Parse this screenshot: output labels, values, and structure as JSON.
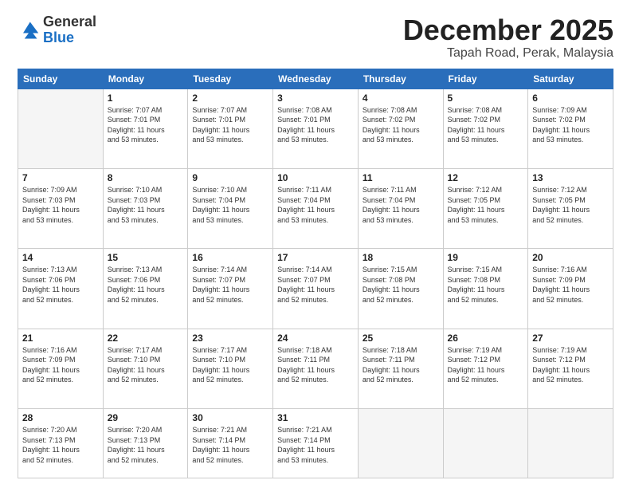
{
  "header": {
    "logo": {
      "general": "General",
      "blue": "Blue"
    },
    "title": "December 2025",
    "subtitle": "Tapah Road, Perak, Malaysia"
  },
  "calendar": {
    "weekdays": [
      "Sunday",
      "Monday",
      "Tuesday",
      "Wednesday",
      "Thursday",
      "Friday",
      "Saturday"
    ],
    "weeks": [
      [
        {
          "day": "",
          "info": ""
        },
        {
          "day": "1",
          "info": "Sunrise: 7:07 AM\nSunset: 7:01 PM\nDaylight: 11 hours\nand 53 minutes."
        },
        {
          "day": "2",
          "info": "Sunrise: 7:07 AM\nSunset: 7:01 PM\nDaylight: 11 hours\nand 53 minutes."
        },
        {
          "day": "3",
          "info": "Sunrise: 7:08 AM\nSunset: 7:01 PM\nDaylight: 11 hours\nand 53 minutes."
        },
        {
          "day": "4",
          "info": "Sunrise: 7:08 AM\nSunset: 7:02 PM\nDaylight: 11 hours\nand 53 minutes."
        },
        {
          "day": "5",
          "info": "Sunrise: 7:08 AM\nSunset: 7:02 PM\nDaylight: 11 hours\nand 53 minutes."
        },
        {
          "day": "6",
          "info": "Sunrise: 7:09 AM\nSunset: 7:02 PM\nDaylight: 11 hours\nand 53 minutes."
        }
      ],
      [
        {
          "day": "7",
          "info": "Sunrise: 7:09 AM\nSunset: 7:03 PM\nDaylight: 11 hours\nand 53 minutes."
        },
        {
          "day": "8",
          "info": "Sunrise: 7:10 AM\nSunset: 7:03 PM\nDaylight: 11 hours\nand 53 minutes."
        },
        {
          "day": "9",
          "info": "Sunrise: 7:10 AM\nSunset: 7:04 PM\nDaylight: 11 hours\nand 53 minutes."
        },
        {
          "day": "10",
          "info": "Sunrise: 7:11 AM\nSunset: 7:04 PM\nDaylight: 11 hours\nand 53 minutes."
        },
        {
          "day": "11",
          "info": "Sunrise: 7:11 AM\nSunset: 7:04 PM\nDaylight: 11 hours\nand 53 minutes."
        },
        {
          "day": "12",
          "info": "Sunrise: 7:12 AM\nSunset: 7:05 PM\nDaylight: 11 hours\nand 53 minutes."
        },
        {
          "day": "13",
          "info": "Sunrise: 7:12 AM\nSunset: 7:05 PM\nDaylight: 11 hours\nand 52 minutes."
        }
      ],
      [
        {
          "day": "14",
          "info": "Sunrise: 7:13 AM\nSunset: 7:06 PM\nDaylight: 11 hours\nand 52 minutes."
        },
        {
          "day": "15",
          "info": "Sunrise: 7:13 AM\nSunset: 7:06 PM\nDaylight: 11 hours\nand 52 minutes."
        },
        {
          "day": "16",
          "info": "Sunrise: 7:14 AM\nSunset: 7:07 PM\nDaylight: 11 hours\nand 52 minutes."
        },
        {
          "day": "17",
          "info": "Sunrise: 7:14 AM\nSunset: 7:07 PM\nDaylight: 11 hours\nand 52 minutes."
        },
        {
          "day": "18",
          "info": "Sunrise: 7:15 AM\nSunset: 7:08 PM\nDaylight: 11 hours\nand 52 minutes."
        },
        {
          "day": "19",
          "info": "Sunrise: 7:15 AM\nSunset: 7:08 PM\nDaylight: 11 hours\nand 52 minutes."
        },
        {
          "day": "20",
          "info": "Sunrise: 7:16 AM\nSunset: 7:09 PM\nDaylight: 11 hours\nand 52 minutes."
        }
      ],
      [
        {
          "day": "21",
          "info": "Sunrise: 7:16 AM\nSunset: 7:09 PM\nDaylight: 11 hours\nand 52 minutes."
        },
        {
          "day": "22",
          "info": "Sunrise: 7:17 AM\nSunset: 7:10 PM\nDaylight: 11 hours\nand 52 minutes."
        },
        {
          "day": "23",
          "info": "Sunrise: 7:17 AM\nSunset: 7:10 PM\nDaylight: 11 hours\nand 52 minutes."
        },
        {
          "day": "24",
          "info": "Sunrise: 7:18 AM\nSunset: 7:11 PM\nDaylight: 11 hours\nand 52 minutes."
        },
        {
          "day": "25",
          "info": "Sunrise: 7:18 AM\nSunset: 7:11 PM\nDaylight: 11 hours\nand 52 minutes."
        },
        {
          "day": "26",
          "info": "Sunrise: 7:19 AM\nSunset: 7:12 PM\nDaylight: 11 hours\nand 52 minutes."
        },
        {
          "day": "27",
          "info": "Sunrise: 7:19 AM\nSunset: 7:12 PM\nDaylight: 11 hours\nand 52 minutes."
        }
      ],
      [
        {
          "day": "28",
          "info": "Sunrise: 7:20 AM\nSunset: 7:13 PM\nDaylight: 11 hours\nand 52 minutes."
        },
        {
          "day": "29",
          "info": "Sunrise: 7:20 AM\nSunset: 7:13 PM\nDaylight: 11 hours\nand 52 minutes."
        },
        {
          "day": "30",
          "info": "Sunrise: 7:21 AM\nSunset: 7:14 PM\nDaylight: 11 hours\nand 52 minutes."
        },
        {
          "day": "31",
          "info": "Sunrise: 7:21 AM\nSunset: 7:14 PM\nDaylight: 11 hours\nand 53 minutes."
        },
        {
          "day": "",
          "info": ""
        },
        {
          "day": "",
          "info": ""
        },
        {
          "day": "",
          "info": ""
        }
      ]
    ]
  }
}
